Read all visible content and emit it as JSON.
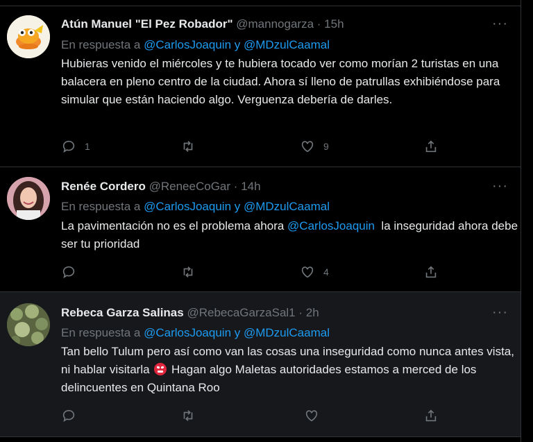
{
  "tweets": [
    {
      "name": "Atún Manuel \"El Pez Robador\"",
      "handle": "@mannogarza",
      "dot": "·",
      "time": "15h",
      "reply_prefix": "En respuesta a",
      "reply_mentions": "@CarlosJoaquin y @MDzulCaamal",
      "text": "Hubieras venido el miércoles y te hubiera tocado ver como morían 2 turistas en una balacera en pleno centro de la ciudad. Ahora sí lleno de patrullas exhibiéndose para simular que están haciendo algo. Verguenza debería de darles.",
      "reply_count": "1",
      "retweet_count": "",
      "like_count": "9",
      "more": "···"
    },
    {
      "name": "Renée Cordero",
      "handle": "@ReneeCoGar",
      "dot": "·",
      "time": "14h",
      "reply_prefix": "En respuesta a",
      "reply_mentions": "@CarlosJoaquin y @MDzulCaamal",
      "text_before": "La pavimentación no es el problema ahora ",
      "text_mention": "@CarlosJoaquin",
      "text_after": "  la inseguridad ahora debe ser tu prioridad",
      "reply_count": "",
      "retweet_count": "",
      "like_count": "4",
      "more": "···"
    },
    {
      "name": "Rebeca Garza Salinas",
      "handle": "@RebecaGarzaSal1",
      "dot": "·",
      "time": "2h",
      "reply_prefix": "En respuesta a",
      "reply_mentions": "@CarlosJoaquin y @MDzulCaamal",
      "text_before": "Tan bello Tulum pero así como van las cosas una inseguridad como nunca antes vista, ni hablar visitarla ",
      "emoji": "angry-face-emoji",
      "text_after": " Hagan algo Maletas autoridades estamos a merced de los delincuentes en Quintana Roo",
      "reply_count": "",
      "retweet_count": "",
      "like_count": "",
      "more": "···"
    }
  ],
  "colors": {
    "background": "#000000",
    "highlight": "#16181c",
    "text": "#e7e9ea",
    "muted": "#71767b",
    "link": "#1d9bf0",
    "border": "#2f3336"
  },
  "icons": {
    "reply": "reply-icon",
    "retweet": "retweet-icon",
    "like": "heart-icon",
    "share": "share-icon",
    "more": "more-options-icon"
  }
}
